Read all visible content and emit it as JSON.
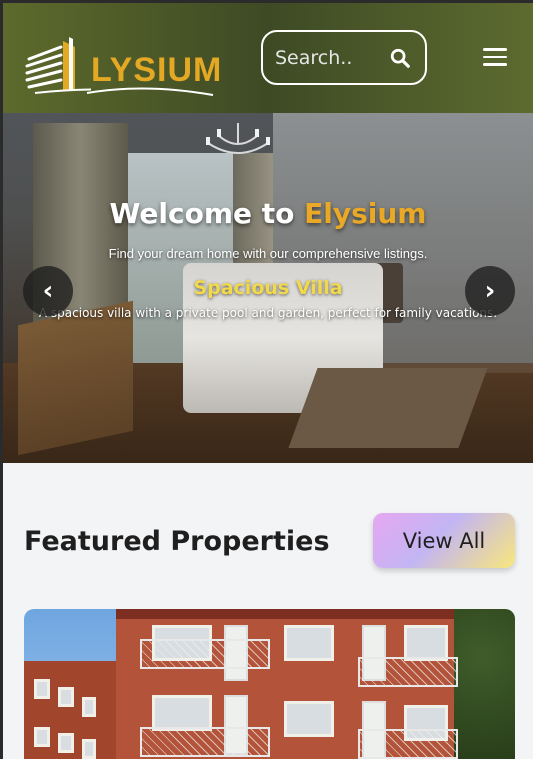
{
  "header": {
    "logo_text": "LYSIUM",
    "search_placeholder": "Search..",
    "colors": {
      "background": "#4e5a29",
      "accent": "#e3a824"
    }
  },
  "hero": {
    "title_prefix": "Welcome to ",
    "title_brand": "Elysium",
    "subtitle": "Find your dream home with our comprehensive listings.",
    "slide": {
      "title": "Spacious Villa",
      "description": "A spacious villa with a private pool and garden, perfect for family vacations."
    },
    "prev_label": "‹",
    "next_label": "›"
  },
  "featured": {
    "title": "Featured Properties",
    "view_all_label": "View All"
  },
  "icons": [
    "logo-icon",
    "search-icon",
    "menu-icon",
    "chevron-left-icon",
    "chevron-right-icon"
  ]
}
